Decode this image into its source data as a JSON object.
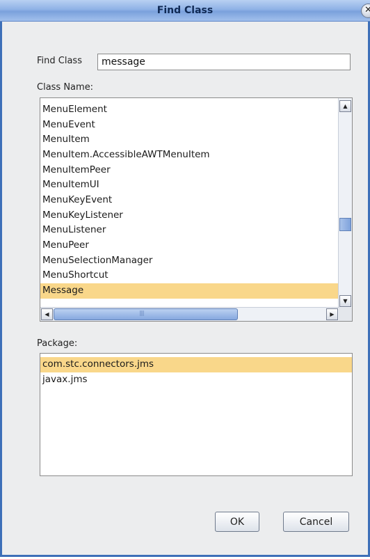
{
  "window": {
    "title": "Find Class",
    "close_symbol": "✕"
  },
  "find": {
    "label": "Find Class",
    "value": "message"
  },
  "class_section": {
    "label": "Class Name:",
    "items": [
      "MenuElement",
      "MenuEvent",
      "MenuItem",
      "MenuItem.AccessibleAWTMenuItem",
      "MenuItemPeer",
      "MenuItemUI",
      "MenuKeyEvent",
      "MenuKeyListener",
      "MenuListener",
      "MenuPeer",
      "MenuSelectionManager",
      "MenuShortcut",
      "Message"
    ],
    "selected": "Message"
  },
  "package_section": {
    "label": "Package:",
    "items": [
      "com.stc.connectors.jms",
      "javax.jms"
    ],
    "selected": "com.stc.connectors.jms"
  },
  "buttons": {
    "ok": "OK",
    "cancel": "Cancel"
  },
  "colors": {
    "selection": "#f9d78a",
    "titlebar": "#8fb2e6",
    "window_border": "#3d6fb8",
    "background": "#ecedee"
  },
  "icons": {
    "scroll_up": "▲",
    "scroll_down": "▼",
    "scroll_left": "◀",
    "scroll_right": "▶",
    "thumb_grip": "||||"
  }
}
